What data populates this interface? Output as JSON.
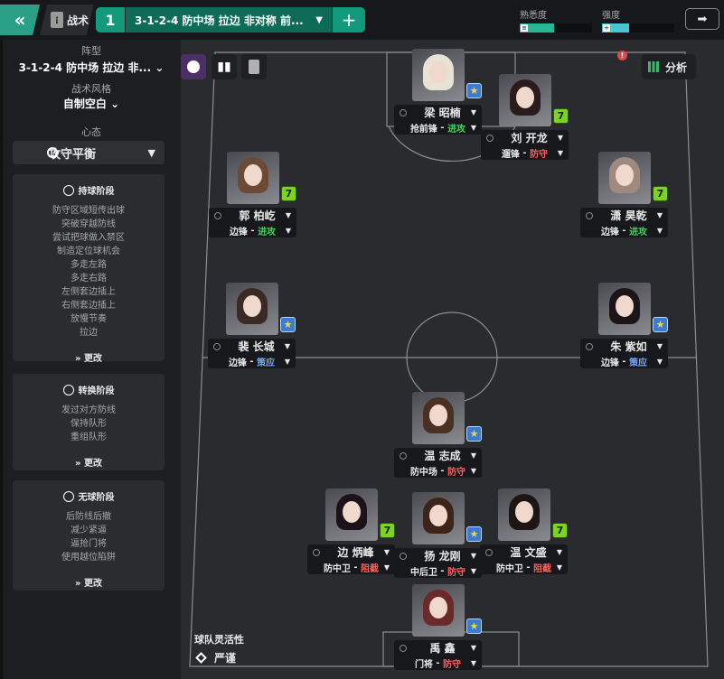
{
  "header": {
    "back_icon": "«",
    "tactic_tab_label": "战术",
    "slot_number": "1",
    "formation_select_label": "3-1-2-4 防中场 拉边 非对称 前...",
    "add_icon": "+",
    "familiarity_label": "熟悉度",
    "familiarity_level": 0.48,
    "intensity_label": "强度",
    "intensity_level": 0.38,
    "exit_icon": "exit-icon",
    "colors": {
      "accent": "#139a7c",
      "familiarity": "#28b694",
      "intensity": "#46c7d3"
    }
  },
  "sidebar": {
    "formation_label": "阵型",
    "formation_value": "3-1-2-4 防中场 拉边 非...",
    "style_label": "战术风格",
    "style_value": "自制空白",
    "mentality_label": "心态",
    "mentality_value": "攻守平衡",
    "phases": [
      {
        "title": "持球阶段",
        "items": [
          "防守区域短传出球",
          "突破穿越防线",
          "尝试把球做入禁区",
          "制造定位球机会",
          "多走左路",
          "多走右路",
          "左侧套边插上",
          "右侧套边插上",
          "放慢节奏",
          "拉边"
        ],
        "change": "更改"
      },
      {
        "title": "转换阶段",
        "items": [
          "发过对方防线",
          "保持队形",
          "重组队形"
        ],
        "change": "更改"
      },
      {
        "title": "无球阶段",
        "items": [
          "后防线后撤",
          "减少紧逼",
          "逼抢门将",
          "使用越位陷阱"
        ],
        "change": "更改"
      }
    ]
  },
  "pitch": {
    "analysis_label": "分析",
    "alert_symbol": "!",
    "flexibility_label": "球队灵活性",
    "flexibility_value": "严谨",
    "players": [
      {
        "name": "梁 昭楠",
        "role": "抢前锋",
        "duty": "进攻",
        "duty_type": "attack",
        "badge": "star",
        "hair": "#e7e2d4"
      },
      {
        "name": "刘 开龙",
        "role": "遛锋",
        "duty": "防守",
        "duty_type": "defend",
        "badge": "7",
        "hair": "#2a1c1c"
      },
      {
        "name": "郭 柏屹",
        "role": "边锋",
        "duty": "进攻",
        "duty_type": "attack",
        "badge": "7",
        "hair": "#6b4a38"
      },
      {
        "name": "潇 昊乾",
        "role": "边锋",
        "duty": "进攻",
        "duty_type": "attack",
        "badge": "7",
        "hair": "#a08a80"
      },
      {
        "name": "裴 长城",
        "role": "边锋",
        "duty": "策应",
        "duty_type": "support",
        "badge": "star",
        "hair": "#3a2a26"
      },
      {
        "name": "朱 紫如",
        "role": "边锋",
        "duty": "策应",
        "duty_type": "support",
        "badge": "star",
        "hair": "#1c1416"
      },
      {
        "name": "温 志成",
        "role": "防中场",
        "duty": "防守",
        "duty_type": "defend",
        "badge": "star",
        "hair": "#4a3020"
      },
      {
        "name": "边 炳峰",
        "role": "防中卫",
        "duty": "阻截",
        "duty_type": "defend",
        "badge": "7",
        "hair": "#1c1218"
      },
      {
        "name": "扬 龙刚",
        "role": "中后卫",
        "duty": "防守",
        "duty_type": "defend",
        "badge": "star",
        "hair": "#3c2418"
      },
      {
        "name": "温 文盛",
        "role": "防中卫",
        "duty": "阻截",
        "duty_type": "defend",
        "badge": "7",
        "hair": "#1e1614"
      },
      {
        "name": "禹 鑫",
        "role": "门将",
        "duty": "防守",
        "duty_type": "defend",
        "badge": "star",
        "hair": "#6a2a2a"
      }
    ]
  }
}
